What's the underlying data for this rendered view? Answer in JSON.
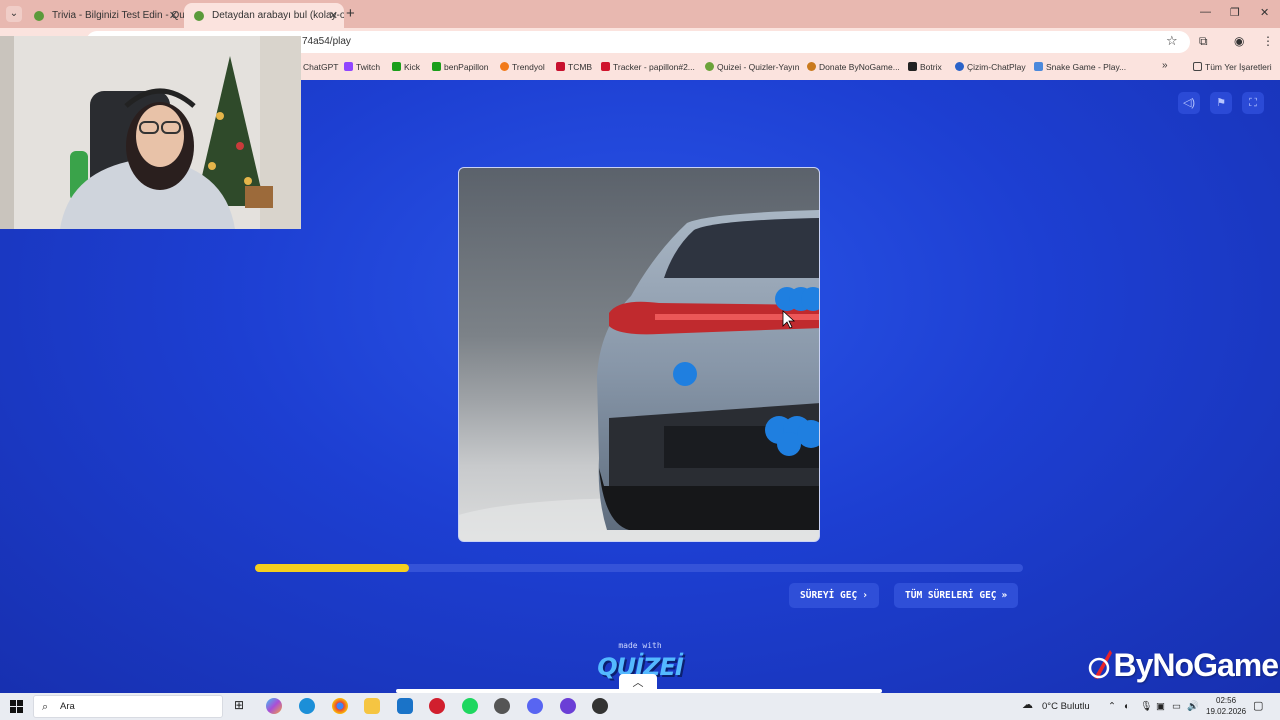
{
  "browser": {
    "tabs": [
      {
        "title": "Trivia - Bilginizi Test Edin - Quiz",
        "active": false
      },
      {
        "title": "Detaydan arabayı bul (kolay-orta)",
        "active": true
      }
    ],
    "url": "74a54/play",
    "bookmarks": [
      "ChatGPT",
      "Twitch",
      "Kick",
      "benPapillon",
      "Trendyol",
      "TCMB",
      "Tracker - papillon#2...",
      "Quizei - Quizler-Yayın",
      "Donate ByNoGame...",
      "Botrix",
      "Çizim-ChatPlay",
      "Snake Game - Play..."
    ],
    "all_bookmarks_label": "Tüm Yer İşaretleri"
  },
  "quiz": {
    "progress_fraction": 0.2,
    "skip_time_label": "SÜREYİ GEÇ",
    "skip_all_label": "TÜM SÜRELERİ GEÇ",
    "made_with_label": "made with",
    "logo_text": "QUİZEİ"
  },
  "overlay": {
    "brand_text": "ByNoGame"
  },
  "taskbar": {
    "search_placeholder": "Ara",
    "weather": "0°C  Bulutlu",
    "time": "02:56",
    "date": "19.02.2026"
  },
  "colors": {
    "page_bg": "#1d3fd2",
    "progress_fill": "#f5cf1e",
    "button_bg": "#2f4fd8",
    "tabstrip": "#e8b8b0"
  }
}
